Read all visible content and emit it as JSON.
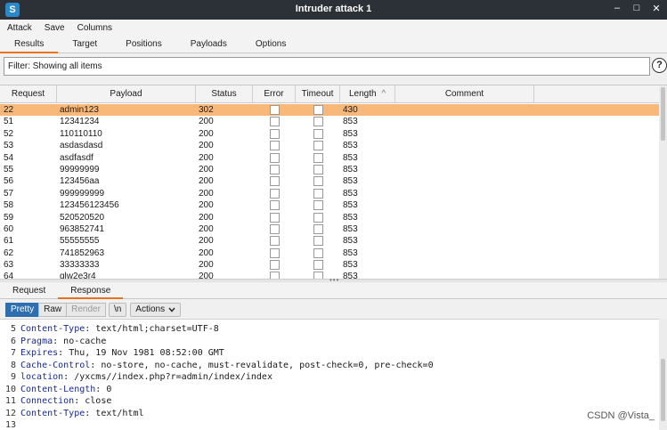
{
  "window": {
    "title": "Intruder attack 1",
    "app_icon": "S"
  },
  "menu": [
    "Attack",
    "Save",
    "Columns"
  ],
  "tabs": [
    "Results",
    "Target",
    "Positions",
    "Payloads",
    "Options"
  ],
  "filter": {
    "text": "Filter: Showing all items",
    "help": "?"
  },
  "table": {
    "columns": [
      "Request",
      "Payload",
      "Status",
      "Error",
      "Timeout",
      "Length",
      "Comment"
    ],
    "sort_indicator": "^",
    "rows": [
      {
        "request": "22",
        "payload": "admin123",
        "status": "302",
        "length": "430"
      },
      {
        "request": "51",
        "payload": "12341234",
        "status": "200",
        "length": "853"
      },
      {
        "request": "52",
        "payload": "110110110",
        "status": "200",
        "length": "853"
      },
      {
        "request": "53",
        "payload": "asdasdasd",
        "status": "200",
        "length": "853"
      },
      {
        "request": "54",
        "payload": "asdfasdf",
        "status": "200",
        "length": "853"
      },
      {
        "request": "55",
        "payload": "99999999",
        "status": "200",
        "length": "853"
      },
      {
        "request": "56",
        "payload": "123456aa",
        "status": "200",
        "length": "853"
      },
      {
        "request": "57",
        "payload": "999999999",
        "status": "200",
        "length": "853"
      },
      {
        "request": "58",
        "payload": "123456123456",
        "status": "200",
        "length": "853"
      },
      {
        "request": "59",
        "payload": "520520520",
        "status": "200",
        "length": "853"
      },
      {
        "request": "60",
        "payload": "963852741",
        "status": "200",
        "length": "853"
      },
      {
        "request": "61",
        "payload": "55555555",
        "status": "200",
        "length": "853"
      },
      {
        "request": "62",
        "payload": "741852963",
        "status": "200",
        "length": "853"
      },
      {
        "request": "63",
        "payload": "33333333",
        "status": "200",
        "length": "853"
      },
      {
        "request": "64",
        "payload": "qlw2e3r4",
        "status": "200",
        "length": "853"
      }
    ],
    "selected_index": 0,
    "grip": "•••"
  },
  "bottom_tabs": [
    "Request",
    "Response"
  ],
  "toolbar": {
    "pretty": "Pretty",
    "raw": "Raw",
    "render": "Render",
    "newline": "\\n",
    "actions": "Actions",
    "actions_icon": "chevron-down-icon"
  },
  "response_lines": [
    {
      "n": "5",
      "key": "Content-Type",
      "val": "text/html;charset=UTF-8"
    },
    {
      "n": "6",
      "key": "Pragma",
      "val": "no-cache"
    },
    {
      "n": "7",
      "key": "Expires",
      "val": "Thu, 19 Nov 1981 08:52:00 GMT"
    },
    {
      "n": "8",
      "key": "Cache-Control",
      "val": "no-store, no-cache, must-revalidate, post-check=0, pre-check=0"
    },
    {
      "n": "9",
      "key": "location",
      "val": "/yxcms//index.php?r=admin/index/index"
    },
    {
      "n": "10",
      "key": "Content-Length",
      "val": "0"
    },
    {
      "n": "11",
      "key": "Connection",
      "val": "close"
    },
    {
      "n": "12",
      "key": "Content-Type",
      "val": "text/html"
    },
    {
      "n": "13",
      "key": "",
      "val": ""
    }
  ],
  "watermark": "CSDN @Vista_",
  "colors": {
    "selected_row": "#f7b87a",
    "tab_accent": "#e8711c",
    "active_button": "#2f6fb0"
  }
}
